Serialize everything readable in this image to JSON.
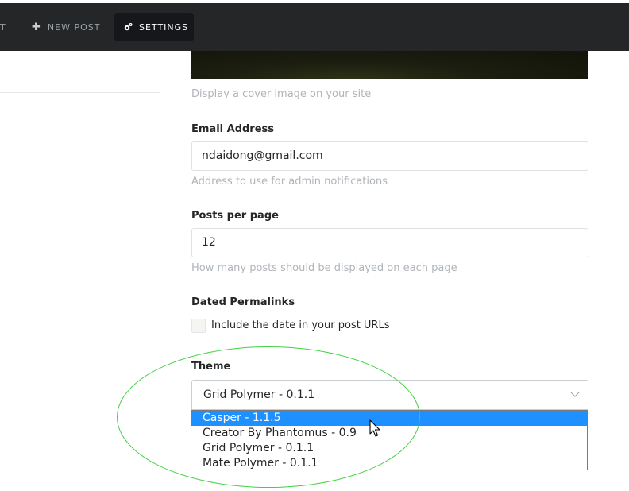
{
  "nav": {
    "cut_label": "T",
    "new_post": {
      "icon": "plus-icon",
      "label": "NEW POST"
    },
    "settings": {
      "icon": "gear-icon",
      "label": "SETTINGS"
    }
  },
  "cover": {
    "help": "Display a cover image on your site"
  },
  "email": {
    "label": "Email Address",
    "value": "ndaidong@gmail.com",
    "help": "Address to use for admin notifications"
  },
  "posts_per_page": {
    "label": "Posts per page",
    "value": "12",
    "help": "How many posts should be displayed on each page"
  },
  "permalinks": {
    "label": "Dated Permalinks",
    "checkbox_label": "Include the date in your post URLs",
    "checked": false
  },
  "theme": {
    "label": "Theme",
    "selected": "Grid Polymer - 0.1.1",
    "options": [
      "Casper - 1.1.5",
      "Creator By Phantomus - 0.9",
      "Grid Polymer - 0.1.1",
      "Mate Polymer - 0.1.1"
    ],
    "highlighted_index": 0
  },
  "colors": {
    "navbar": "#242628",
    "selected_option": "#1e90ff",
    "annotation": "#3fd13f"
  }
}
